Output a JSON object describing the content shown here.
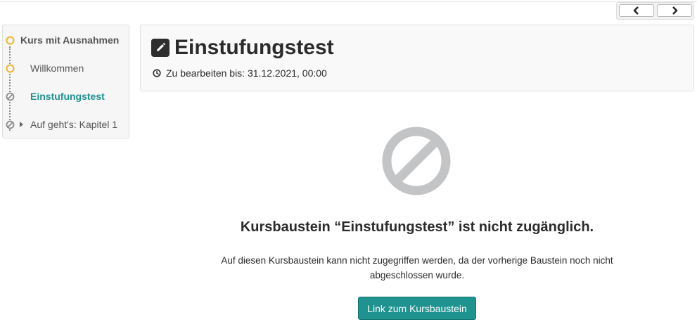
{
  "nav": {
    "prev_icon": "chevron-left-icon",
    "next_icon": "chevron-right-icon"
  },
  "course_menu": {
    "root_label": "Kurs mit Ausnahmen",
    "items": [
      {
        "label": "Willkommen",
        "status": "open"
      },
      {
        "label": "Einstufungstest",
        "status": "blocked",
        "active": true
      },
      {
        "label": "Auf geht's: Kapitel 1",
        "status": "blocked",
        "expandable": true
      }
    ],
    "open_color": "#f0b429",
    "blocked_color": "#8a8a8a",
    "active_color": "#1e9390"
  },
  "header": {
    "icon": "edit-icon",
    "title": "Einstufungstest",
    "deadline_icon": "clock-icon",
    "deadline": "Zu bearbeiten bis: 31.12.2021, 00:00"
  },
  "message": {
    "icon": "blocked-icon",
    "title": "Kursbaustein “Einstufungstest” ist nicht zugänglich.",
    "body": "Auf diesen Kursbaustein kann nicht zugegriffen werden, da der vorherige Baustein noch nicht abgeschlossen wurde.",
    "button_label": "Link zum Kursbaustein",
    "button_color": "#1e9390"
  }
}
